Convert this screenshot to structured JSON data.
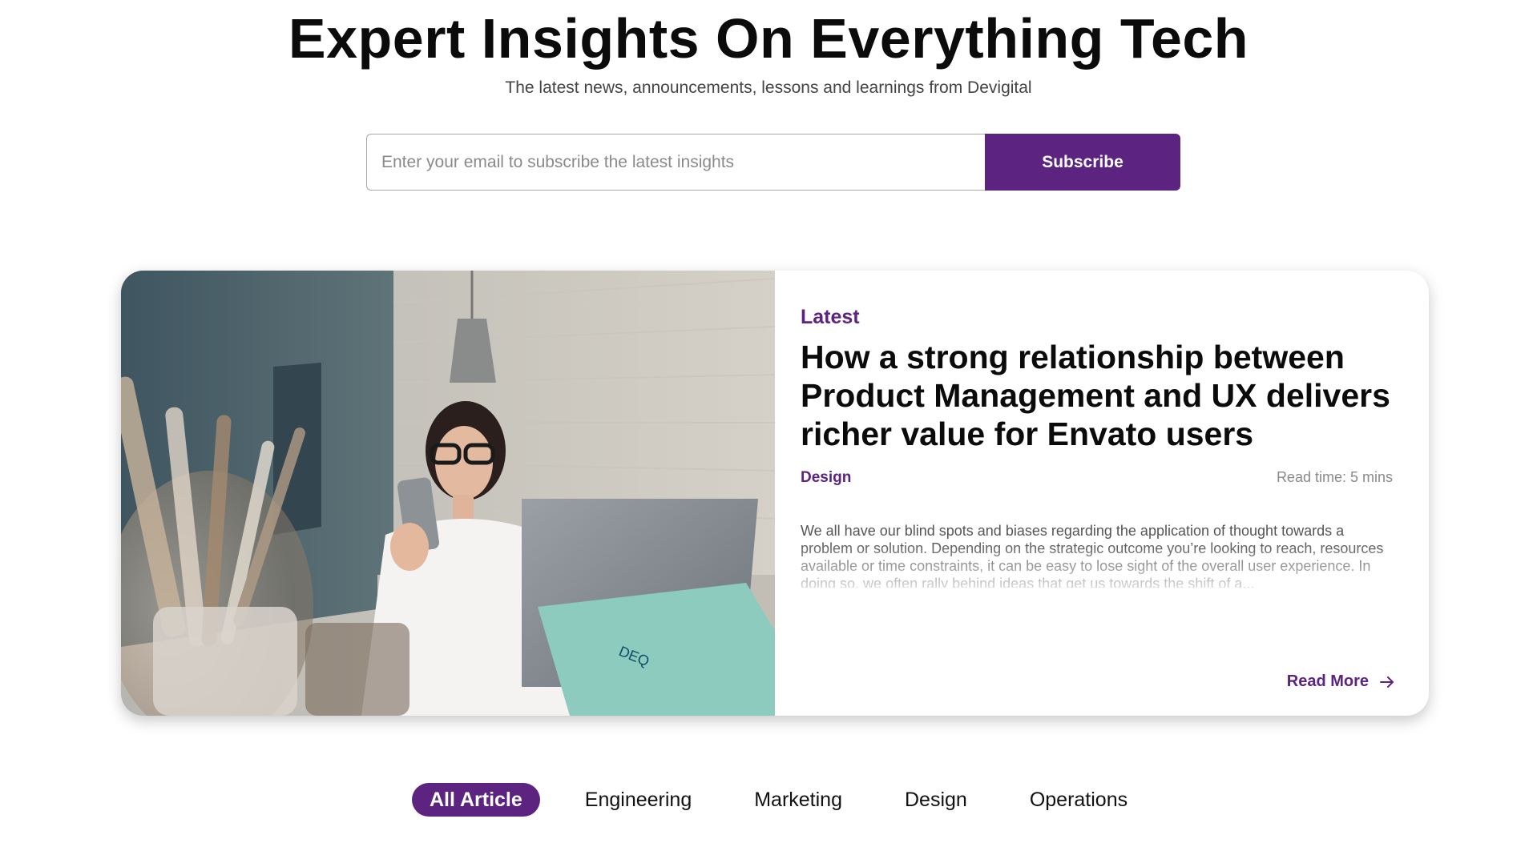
{
  "hero": {
    "title": "Expert Insights On Everything Tech",
    "subtitle": "The latest news, announcements, lessons and learnings from Devigital"
  },
  "subscribe": {
    "placeholder": "Enter your email to subscribe the latest insights",
    "button_label": "Subscribe"
  },
  "featured": {
    "label": "Latest",
    "title": "How a strong relationship between Product Management and UX delivers richer value for Envato users",
    "category": "Design",
    "read_time": "Read time: 5 mins",
    "excerpt": "We all have our blind spots and biases regarding the application of thought towards a problem or solution. Depending on the strategic outcome you’re looking to reach, resources available or time constraints, it can be easy to lose sight of the overall user experience. In doing so, we often rally behind ideas that get us towards the shift of a...",
    "read_more_label": "Read More",
    "image_icon": "photo-woman-with-phone-and-laptop"
  },
  "tabs": [
    {
      "label": "All Article",
      "active": true
    },
    {
      "label": "Engineering",
      "active": false
    },
    {
      "label": "Marketing",
      "active": false
    },
    {
      "label": "Design",
      "active": false
    },
    {
      "label": "Operations",
      "active": false
    }
  ],
  "colors": {
    "accent": "#5d2380",
    "text": "#0b0b0b",
    "muted": "#8a8a8a"
  }
}
